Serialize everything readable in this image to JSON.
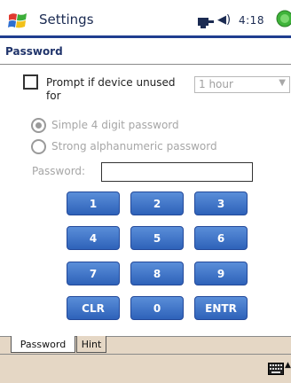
{
  "titlebar": {
    "app_title": "Settings",
    "clock": "4:18"
  },
  "section": {
    "title": "Password"
  },
  "prompt": {
    "label": "Prompt if device unused for",
    "timeout_value": "1 hour"
  },
  "radios": {
    "simple_label": "Simple 4 digit password",
    "strong_label": "Strong alphanumeric password",
    "selected": "simple"
  },
  "password": {
    "label": "Password:",
    "value": ""
  },
  "keypad": {
    "keys": [
      "1",
      "2",
      "3",
      "4",
      "5",
      "6",
      "7",
      "8",
      "9",
      "CLR",
      "0",
      "ENTR"
    ]
  },
  "tabs": {
    "password": "Password",
    "hint": "Hint"
  },
  "colors": {
    "title_bar_border": "#1f3d8f",
    "key_blue": "#3a6fc4",
    "tab_background": "#e5d7c5"
  },
  "icons": [
    "windows-logo-icon",
    "signal-icon",
    "volume-icon",
    "ok-icon",
    "keyboard-icon",
    "chevron-up-icon",
    "chevron-down-icon"
  ]
}
